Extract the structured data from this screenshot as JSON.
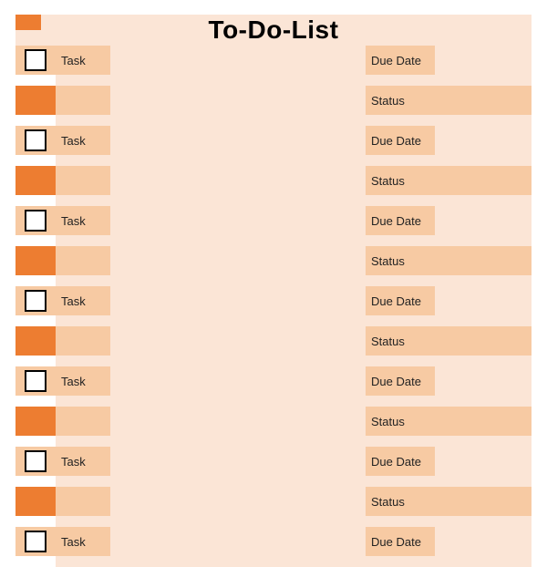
{
  "title": "To-Do-List",
  "labels": {
    "task": "Task",
    "due": "Due Date",
    "status": "Status"
  },
  "rows": [
    {
      "task": "",
      "due": "",
      "status": ""
    },
    {
      "task": "",
      "due": "",
      "status": ""
    },
    {
      "task": "",
      "due": "",
      "status": ""
    },
    {
      "task": "",
      "due": "",
      "status": ""
    },
    {
      "task": "",
      "due": "",
      "status": ""
    },
    {
      "task": "",
      "due": "",
      "status": ""
    },
    {
      "task": "",
      "due": "",
      "status": ""
    }
  ]
}
